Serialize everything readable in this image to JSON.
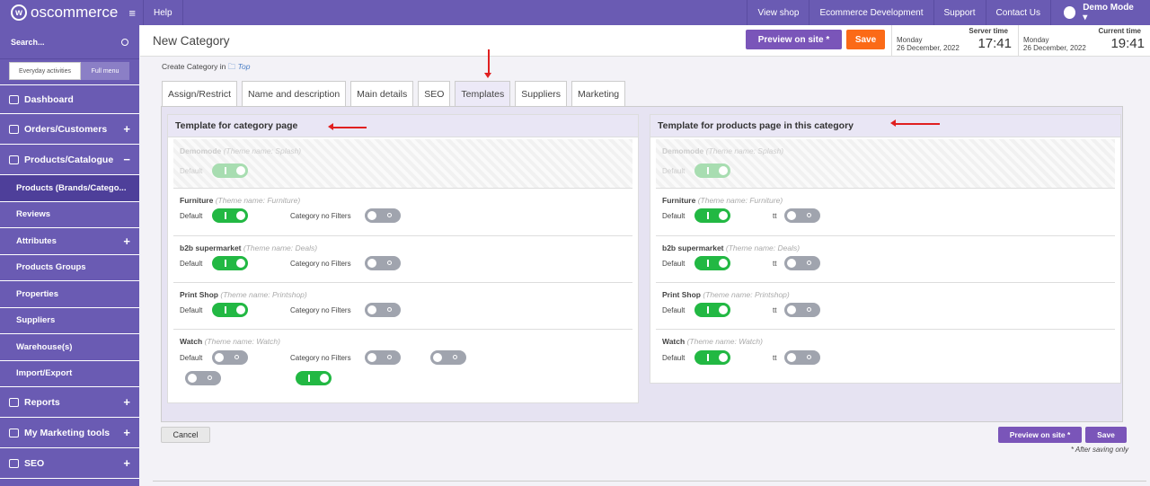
{
  "topbar": {
    "logo": "oscommerce",
    "logo_mark": "w",
    "menu_icon": "≡",
    "help": "Help",
    "links": [
      "View shop",
      "Ecommerce Development",
      "Support",
      "Contact Us"
    ],
    "user": "Demo Mode ▾"
  },
  "sidebar": {
    "search_label": "Search...",
    "toggle_a": "Everyday activities",
    "toggle_b": "Full menu",
    "items": {
      "dashboard": "Dashboard",
      "orders": "Orders/Customers",
      "products": "Products/Catalogue",
      "products_brands": "Products (Brands/Catego...",
      "reviews": "Reviews",
      "attributes": "Attributes",
      "products_groups": "Products Groups",
      "properties": "Properties",
      "suppliers": "Suppliers",
      "warehouses": "Warehouse(s)",
      "import_export": "Import/Export",
      "reports": "Reports",
      "marketing": "My Marketing tools",
      "seo": "SEO"
    },
    "plus": "+",
    "minus": "−"
  },
  "header": {
    "title": "New Category",
    "preview": "Preview on site *",
    "save": "Save",
    "server_time_label": "Server time",
    "current_time_label": "Current time",
    "day": "Monday",
    "date": "26 December, 2022",
    "server_time": "17:41",
    "current_time": "19:41"
  },
  "breadcrumb": {
    "text": "Create Category in",
    "top": "Top"
  },
  "tabs": [
    "Assign/Restrict",
    "Name and description",
    "Main details",
    "SEO",
    "Templates",
    "Suppliers",
    "Marketing"
  ],
  "left_box": {
    "title": "Template for category page",
    "groups": [
      {
        "name": "Demomode",
        "theme": "(Theme name: Splash)",
        "labels": [
          "Default"
        ]
      },
      {
        "name": "Furniture",
        "theme": "(Theme name: Furniture)",
        "labels": [
          "Default",
          "Category no Filters"
        ]
      },
      {
        "name": "b2b supermarket",
        "theme": "(Theme name: Deals)",
        "labels": [
          "Default",
          "Category no Filters"
        ]
      },
      {
        "name": "Print Shop",
        "theme": "(Theme name: Printshop)",
        "labels": [
          "Default",
          "Category no Filters"
        ]
      },
      {
        "name": "Watch",
        "theme": "(Theme name: Watch)",
        "labels": [
          "Default",
          "Category no Filters"
        ]
      }
    ]
  },
  "right_box": {
    "title": "Template for products page in this category",
    "groups": [
      {
        "name": "Demomode",
        "theme": "(Theme name: Splash)",
        "labels": [
          "Default"
        ]
      },
      {
        "name": "Furniture",
        "theme": "(Theme name: Furniture)",
        "labels": [
          "Default",
          "tt"
        ]
      },
      {
        "name": "b2b supermarket",
        "theme": "(Theme name: Deals)",
        "labels": [
          "Default",
          "tt"
        ]
      },
      {
        "name": "Print Shop",
        "theme": "(Theme name: Printshop)",
        "labels": [
          "Default",
          "tt"
        ]
      },
      {
        "name": "Watch",
        "theme": "(Theme name: Watch)",
        "labels": [
          "Default",
          "tt"
        ]
      }
    ]
  },
  "footer": {
    "cancel": "Cancel",
    "preview": "Preview on site *",
    "save": "Save",
    "note": "* After saving only"
  },
  "colors": {
    "brand": "#6a5bb3",
    "save": "#fb6a17",
    "toggle_on": "#22b843",
    "toggle_off": "#a0a4ae"
  }
}
